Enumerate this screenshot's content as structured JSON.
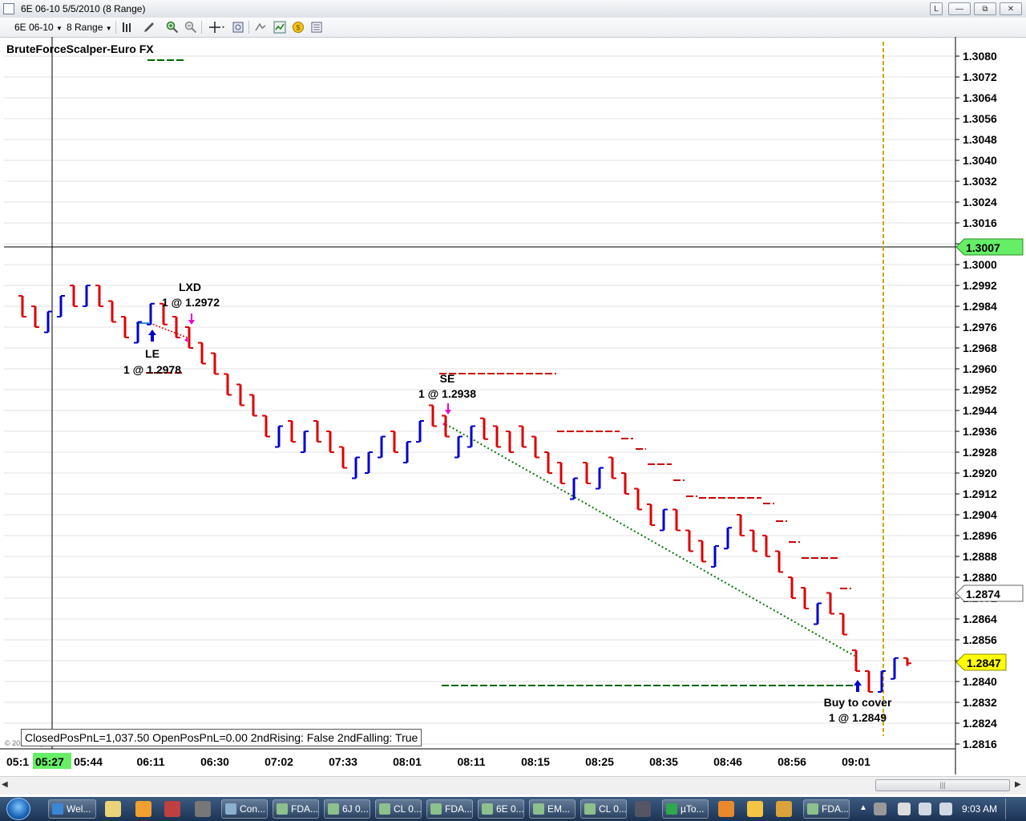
{
  "window": {
    "title": "6E 06-10  5/5/2010 (8 Range)",
    "buttons": [
      "L",
      "—",
      "⧉",
      "✕"
    ]
  },
  "toolbar": {
    "instrument": "6E 06-10",
    "bar_type": "8 Range"
  },
  "chart": {
    "strategy_title": "BruteForceScalper-Euro FX",
    "price_ticks": [
      "1.3080",
      "1.3072",
      "1.3064",
      "1.3056",
      "1.3048",
      "1.3040",
      "1.3032",
      "1.3024",
      "1.3016",
      "1.3008",
      "1.3000",
      "1.2992",
      "1.2984",
      "1.2976",
      "1.2968",
      "1.2960",
      "1.2952",
      "1.2944",
      "1.2936",
      "1.2928",
      "1.2920",
      "1.2912",
      "1.2904",
      "1.2896",
      "1.2888",
      "1.2880",
      "1.2872",
      "1.2864",
      "1.2856",
      "1.2848",
      "1.2840",
      "1.2832",
      "1.2824",
      "1.2816"
    ],
    "crosshair_price": "1.3007",
    "marker_price": "1.2874",
    "last_price": "1.2847",
    "time_ticks": [
      "05:1",
      "05:44",
      "06:11",
      "06:30",
      "07:02",
      "07:33",
      "08:01",
      "08:11",
      "08:15",
      "08:25",
      "08:35",
      "08:46",
      "08:56",
      "09:01"
    ],
    "crosshair_time": "05:27",
    "orders": {
      "lxd_label": "LXD",
      "lxd_fill": "1 @ 1.2972",
      "le_label": "LE",
      "le_fill": "1 @ 1.2978",
      "se_label": "SE",
      "se_fill": "1 @ 1.2938",
      "cover_label": "Buy to cover",
      "cover_fill": "1 @ 1.2849"
    },
    "status_text": "ClosedPosPnL=1,037.50 OpenPosPnL=0.00 2ndRising: False 2ndFalling: True",
    "copyright": "© 2010 NinjaTrader, LLC",
    "colors": {
      "up_bar": "#0000cc",
      "down_bar": "#dd0000",
      "stop_dash": "#cc0000",
      "target_dash": "#006600",
      "session_line": "#d4a017",
      "last_price_bg": "#ffff00",
      "crosshair_price_bg": "#66ee66"
    },
    "bars": [
      {
        "d": "down",
        "o": 1.2988,
        "h": 1.2988,
        "l": 1.298,
        "c": 1.298
      },
      {
        "d": "down",
        "o": 1.2984,
        "h": 1.2984,
        "l": 1.2976,
        "c": 1.2976
      },
      {
        "d": "up",
        "o": 1.2974,
        "h": 1.2982,
        "l": 1.2974,
        "c": 1.2982
      },
      {
        "d": "up",
        "o": 1.298,
        "h": 1.2988,
        "l": 1.298,
        "c": 1.2988
      },
      {
        "d": "down",
        "o": 1.2992,
        "h": 1.2992,
        "l": 1.2984,
        "c": 1.2984
      },
      {
        "d": "up",
        "o": 1.2984,
        "h": 1.2992,
        "l": 1.2984,
        "c": 1.2992
      },
      {
        "d": "down",
        "o": 1.2992,
        "h": 1.2992,
        "l": 1.2984,
        "c": 1.2984
      },
      {
        "d": "down",
        "o": 1.2986,
        "h": 1.2986,
        "l": 1.2978,
        "c": 1.2978
      },
      {
        "d": "down",
        "o": 1.298,
        "h": 1.298,
        "l": 1.2972,
        "c": 1.2972
      },
      {
        "d": "up",
        "o": 1.297,
        "h": 1.2978,
        "l": 1.297,
        "c": 1.2978
      },
      {
        "d": "up",
        "o": 1.2977,
        "h": 1.2985,
        "l": 1.2977,
        "c": 1.2985
      },
      {
        "d": "down",
        "o": 1.2985,
        "h": 1.2985,
        "l": 1.2977,
        "c": 1.2977
      },
      {
        "d": "down",
        "o": 1.298,
        "h": 1.298,
        "l": 1.2972,
        "c": 1.2972
      },
      {
        "d": "down",
        "o": 1.2976,
        "h": 1.2976,
        "l": 1.2968,
        "c": 1.2968
      },
      {
        "d": "down",
        "o": 1.297,
        "h": 1.297,
        "l": 1.2962,
        "c": 1.2962
      },
      {
        "d": "down",
        "o": 1.2966,
        "h": 1.2966,
        "l": 1.2958,
        "c": 1.2958
      },
      {
        "d": "down",
        "o": 1.2958,
        "h": 1.2958,
        "l": 1.295,
        "c": 1.295
      },
      {
        "d": "down",
        "o": 1.2954,
        "h": 1.2954,
        "l": 1.2946,
        "c": 1.2946
      },
      {
        "d": "down",
        "o": 1.295,
        "h": 1.295,
        "l": 1.2942,
        "c": 1.2942
      },
      {
        "d": "down",
        "o": 1.2942,
        "h": 1.2942,
        "l": 1.2934,
        "c": 1.2934
      },
      {
        "d": "up",
        "o": 1.293,
        "h": 1.2938,
        "l": 1.293,
        "c": 1.2938
      },
      {
        "d": "down",
        "o": 1.294,
        "h": 1.294,
        "l": 1.2932,
        "c": 1.2932
      },
      {
        "d": "up",
        "o": 1.2928,
        "h": 1.2936,
        "l": 1.2928,
        "c": 1.2936
      },
      {
        "d": "down",
        "o": 1.294,
        "h": 1.294,
        "l": 1.2932,
        "c": 1.2932
      },
      {
        "d": "down",
        "o": 1.2936,
        "h": 1.2936,
        "l": 1.2928,
        "c": 1.2928
      },
      {
        "d": "down",
        "o": 1.293,
        "h": 1.293,
        "l": 1.2922,
        "c": 1.2922
      },
      {
        "d": "up",
        "o": 1.2918,
        "h": 1.2926,
        "l": 1.2918,
        "c": 1.2926
      },
      {
        "d": "up",
        "o": 1.292,
        "h": 1.2928,
        "l": 1.292,
        "c": 1.2928
      },
      {
        "d": "up",
        "o": 1.2926,
        "h": 1.2934,
        "l": 1.2926,
        "c": 1.2934
      },
      {
        "d": "down",
        "o": 1.2936,
        "h": 1.2936,
        "l": 1.2928,
        "c": 1.2928
      },
      {
        "d": "up",
        "o": 1.2924,
        "h": 1.2932,
        "l": 1.2924,
        "c": 1.2932
      },
      {
        "d": "up",
        "o": 1.2932,
        "h": 1.294,
        "l": 1.2932,
        "c": 1.294
      },
      {
        "d": "down",
        "o": 1.2946,
        "h": 1.2946,
        "l": 1.2938,
        "c": 1.2938
      },
      {
        "d": "down",
        "o": 1.2942,
        "h": 1.2942,
        "l": 1.2934,
        "c": 1.2934
      },
      {
        "d": "up",
        "o": 1.2926,
        "h": 1.2934,
        "l": 1.2926,
        "c": 1.2934
      },
      {
        "d": "up",
        "o": 1.293,
        "h": 1.2938,
        "l": 1.293,
        "c": 1.2938
      },
      {
        "d": "down",
        "o": 1.2941,
        "h": 1.2941,
        "l": 1.2933,
        "c": 1.2933
      },
      {
        "d": "down",
        "o": 1.2938,
        "h": 1.2938,
        "l": 1.293,
        "c": 1.293
      },
      {
        "d": "down",
        "o": 1.2936,
        "h": 1.2936,
        "l": 1.2928,
        "c": 1.2928
      },
      {
        "d": "down",
        "o": 1.2938,
        "h": 1.2938,
        "l": 1.293,
        "c": 1.293
      },
      {
        "d": "down",
        "o": 1.2934,
        "h": 1.2934,
        "l": 1.2926,
        "c": 1.2926
      },
      {
        "d": "down",
        "o": 1.2928,
        "h": 1.2928,
        "l": 1.292,
        "c": 1.292
      },
      {
        "d": "down",
        "o": 1.2924,
        "h": 1.2924,
        "l": 1.2916,
        "c": 1.2916
      },
      {
        "d": "up",
        "o": 1.291,
        "h": 1.2918,
        "l": 1.291,
        "c": 1.2918
      },
      {
        "d": "down",
        "o": 1.2924,
        "h": 1.2924,
        "l": 1.2916,
        "c": 1.2916
      },
      {
        "d": "up",
        "o": 1.2914,
        "h": 1.2922,
        "l": 1.2914,
        "c": 1.2922
      },
      {
        "d": "down",
        "o": 1.2926,
        "h": 1.2926,
        "l": 1.2918,
        "c": 1.2918
      },
      {
        "d": "down",
        "o": 1.292,
        "h": 1.292,
        "l": 1.2912,
        "c": 1.2912
      },
      {
        "d": "down",
        "o": 1.2914,
        "h": 1.2914,
        "l": 1.2906,
        "c": 1.2906
      },
      {
        "d": "down",
        "o": 1.2908,
        "h": 1.2908,
        "l": 1.29,
        "c": 1.29
      },
      {
        "d": "up",
        "o": 1.2898,
        "h": 1.2906,
        "l": 1.2898,
        "c": 1.2906
      },
      {
        "d": "down",
        "o": 1.2906,
        "h": 1.2906,
        "l": 1.2898,
        "c": 1.2898
      },
      {
        "d": "down",
        "o": 1.2898,
        "h": 1.2898,
        "l": 1.289,
        "c": 1.289
      },
      {
        "d": "down",
        "o": 1.2894,
        "h": 1.2894,
        "l": 1.2886,
        "c": 1.2886
      },
      {
        "d": "up",
        "o": 1.2884,
        "h": 1.2892,
        "l": 1.2884,
        "c": 1.2892
      },
      {
        "d": "up",
        "o": 1.2891,
        "h": 1.2899,
        "l": 1.2891,
        "c": 1.2899
      },
      {
        "d": "down",
        "o": 1.2904,
        "h": 1.2904,
        "l": 1.2896,
        "c": 1.2896
      },
      {
        "d": "down",
        "o": 1.2898,
        "h": 1.2898,
        "l": 1.289,
        "c": 1.289
      },
      {
        "d": "down",
        "o": 1.2896,
        "h": 1.2896,
        "l": 1.2888,
        "c": 1.2888
      },
      {
        "d": "down",
        "o": 1.289,
        "h": 1.289,
        "l": 1.2882,
        "c": 1.2882
      },
      {
        "d": "down",
        "o": 1.288,
        "h": 1.288,
        "l": 1.2872,
        "c": 1.2872
      },
      {
        "d": "down",
        "o": 1.2876,
        "h": 1.2876,
        "l": 1.2868,
        "c": 1.2868
      },
      {
        "d": "up",
        "o": 1.2862,
        "h": 1.287,
        "l": 1.2862,
        "c": 1.287
      },
      {
        "d": "down",
        "o": 1.2874,
        "h": 1.2874,
        "l": 1.2866,
        "c": 1.2866
      },
      {
        "d": "down",
        "o": 1.2866,
        "h": 1.2866,
        "l": 1.2858,
        "c": 1.2858
      },
      {
        "d": "down",
        "o": 1.2852,
        "h": 1.2852,
        "l": 1.2844,
        "c": 1.2844
      },
      {
        "d": "down",
        "o": 1.2844,
        "h": 1.2844,
        "l": 1.2836,
        "c": 1.2836
      },
      {
        "d": "up",
        "o": 1.2836,
        "h": 1.2844,
        "l": 1.2836,
        "c": 1.2844
      },
      {
        "d": "up",
        "o": 1.2841,
        "h": 1.2849,
        "l": 1.2841,
        "c": 1.2849
      },
      {
        "d": "down",
        "o": 1.2849,
        "h": 1.2849,
        "l": 1.2846,
        "c": 1.2847
      }
    ]
  },
  "taskbar": {
    "items": [
      "Wel...",
      "",
      "",
      "",
      "",
      "Con...",
      "FDA...",
      "6J 0...",
      "CL 0...",
      "FDA...",
      "6E 0...",
      "EM...",
      "CL 0...",
      "",
      "µTo...",
      "",
      "",
      "",
      "FDA..."
    ],
    "clock": "9:03 AM"
  }
}
